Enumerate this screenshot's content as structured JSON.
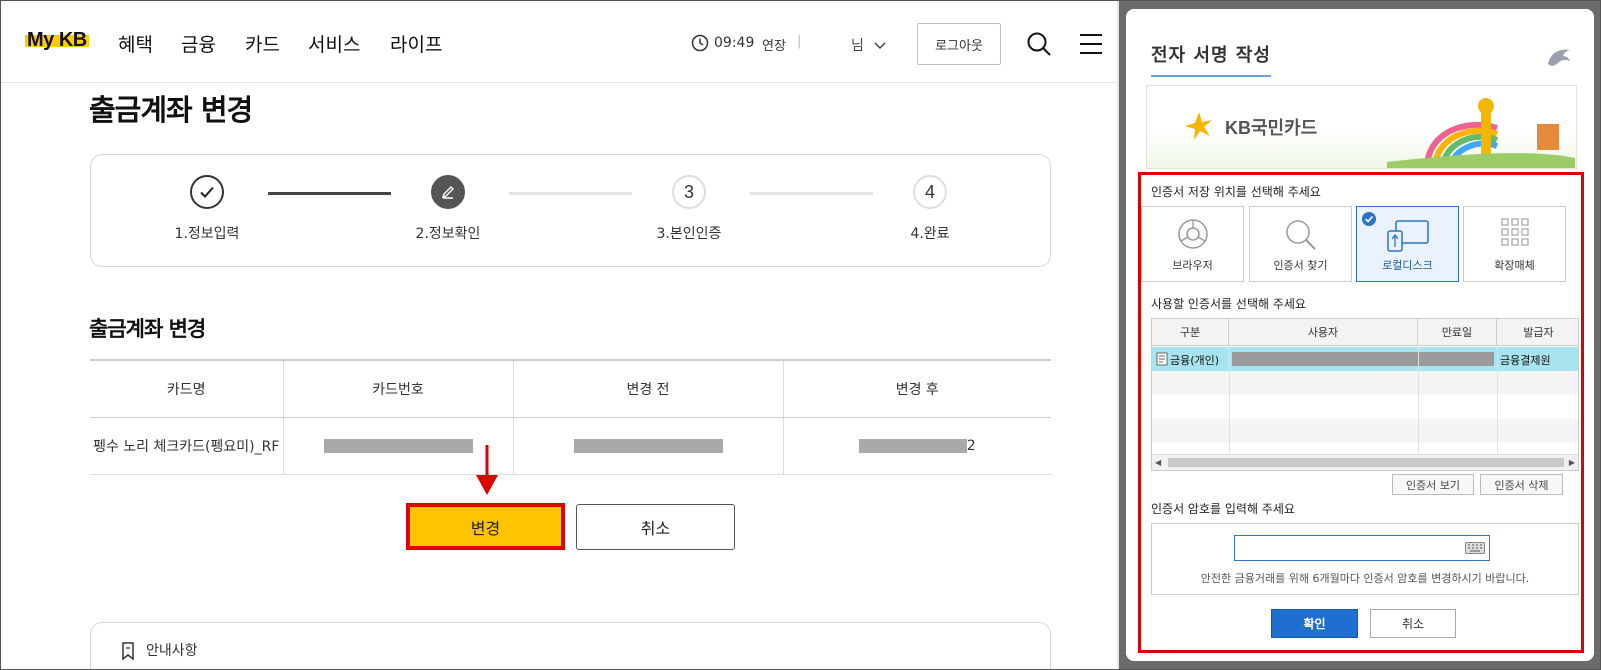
{
  "header": {
    "logo": "My KB",
    "nav": [
      "혜택",
      "금융",
      "카드",
      "서비스",
      "라이프"
    ],
    "timer": "09:49",
    "extend_label": "연장",
    "separator": "|",
    "user_suffix": "님",
    "logout_label": "로그아웃"
  },
  "page": {
    "title": "출금계좌 변경",
    "steps": [
      {
        "number": "",
        "label": "1.정보입력",
        "state": "done"
      },
      {
        "number": "",
        "label": "2.정보확인",
        "state": "current"
      },
      {
        "number": "3",
        "label": "3.본인인증",
        "state": "pending"
      },
      {
        "number": "4",
        "label": "4.완료",
        "state": "pending"
      }
    ],
    "section_title": "출금계좌 변경",
    "table": {
      "headers": [
        "카드명",
        "카드번호",
        "변경 전",
        "변경 후"
      ],
      "row": {
        "card_name": "펭수 노리 체크카드(펭요미)_RF",
        "after_suffix": "2"
      }
    },
    "change_button": "변경",
    "cancel_button": "취소",
    "notice_label": "안내사항"
  },
  "dialog": {
    "title": "전자 서명 작성",
    "banner_brand": "KB국민카드",
    "location_prompt": "인증서 저장 위치를 선택해 주세요",
    "locations": [
      "브라우저",
      "인증서 찾기",
      "로컬디스크",
      "확장매체"
    ],
    "selected_location": "로컬디스크",
    "cert_prompt": "사용할 인증서를 선택해 주세요",
    "cert_columns": [
      "구분",
      "사용자",
      "만료일",
      "발급자"
    ],
    "cert_row": {
      "type": "금융(개인)",
      "issuer": "금융결제원"
    },
    "view_cert_button": "인증서 보기",
    "delete_cert_button": "인증서 삭제",
    "password_prompt": "인증서 암호를 입력해 주세요",
    "password_value": "",
    "password_hint": "안전한 금융거래를 위해 6개월마다 인증서 암호를 변경하시기 바랍니다.",
    "ok_button": "확인",
    "cancel_button": "취소"
  },
  "colors": {
    "kb_yellow": "#ffc400",
    "highlight_red": "#e00000",
    "dialog_blue": "#1e6fd0",
    "selected_row": "#a8e4ef"
  }
}
